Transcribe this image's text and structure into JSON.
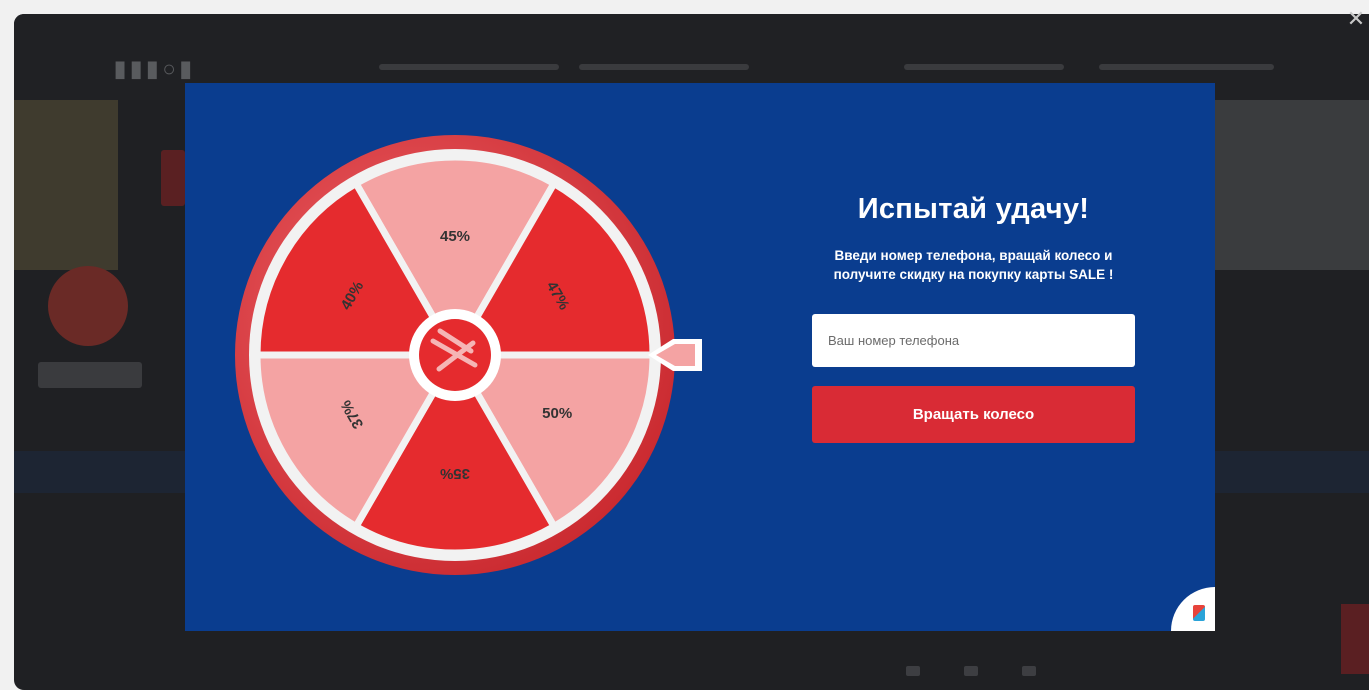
{
  "modal": {
    "headline": "Испытай удачу!",
    "subtext": "Введи номер телефона, вращай колесо и получите скидку на покупку карты SALE !",
    "phone_placeholder": "Ваш номер телефона",
    "spin_button": "Вращать колесо",
    "close_icon": "close-icon"
  },
  "wheel": {
    "segments": [
      {
        "label": "45%",
        "color": "#f4a3a3"
      },
      {
        "label": "47%",
        "color": "#e52b2e"
      },
      {
        "label": "50%",
        "color": "#f4a3a3"
      },
      {
        "label": "35%",
        "color": "#e52b2e"
      },
      {
        "label": "37%",
        "color": "#f4a3a3"
      },
      {
        "label": "40%",
        "color": "#e52b2e"
      }
    ],
    "label_color": "#333333"
  },
  "colors": {
    "modal_bg": "#0a3d8f",
    "button": "#d92b35",
    "wheel_rim": "#e8434a"
  }
}
